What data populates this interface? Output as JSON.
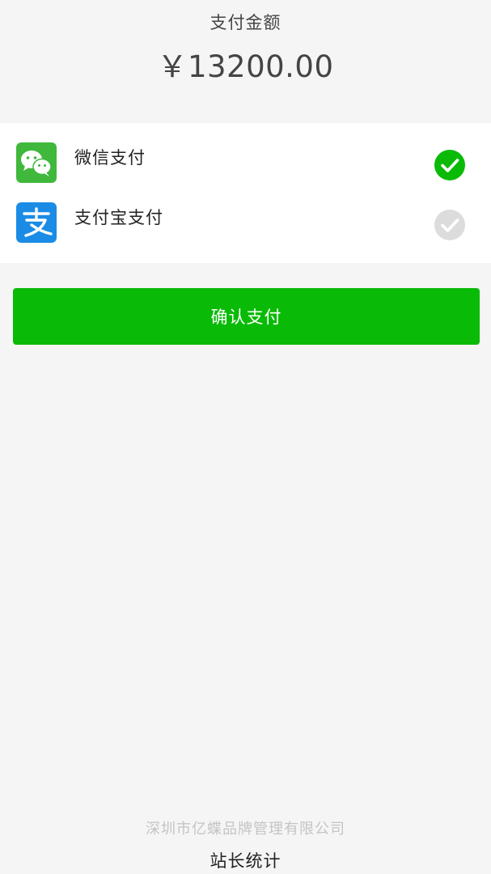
{
  "payment": {
    "amount_label": "支付金额",
    "amount_value": "￥13200.00"
  },
  "methods": [
    {
      "id": "wechat",
      "label": "微信支付",
      "icon": "wechat-pay-icon",
      "selected": true
    },
    {
      "id": "alipay",
      "label": "支付宝支付",
      "icon": "alipay-icon",
      "selected": false
    }
  ],
  "confirm_button": {
    "label": "确认支付"
  },
  "footer": {
    "company": "深圳市亿蝶品牌管理有限公司",
    "link": "站长统计"
  },
  "colors": {
    "background": "#f5f5f5",
    "card": "#ffffff",
    "primary_green": "#09bb07",
    "check_selected": "#09bb07",
    "check_unselected": "#dcdcdc",
    "wechat_icon_bg": "#3fb83b",
    "alipay_icon_bg": "#1a8ce6",
    "footer_text": "#c4c4c4"
  }
}
